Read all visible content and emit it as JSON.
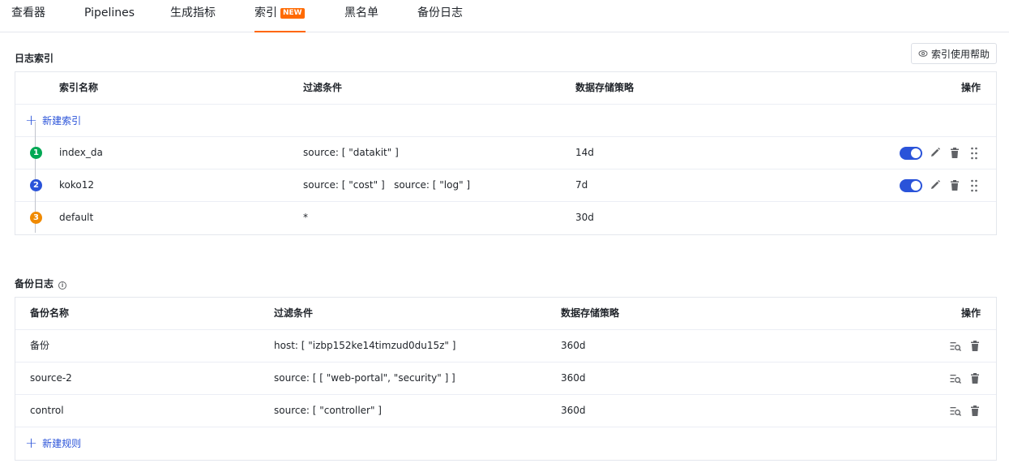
{
  "tabs": [
    {
      "label": "查看器"
    },
    {
      "label": "Pipelines"
    },
    {
      "label": "生成指标"
    },
    {
      "label": "索引",
      "badge": "NEW"
    },
    {
      "label": "黑名单"
    },
    {
      "label": "备份日志"
    }
  ],
  "active_tab": "索引",
  "accent_color": "#ff6600",
  "link_color": "#2a53d9",
  "log_index": {
    "title": "日志索引",
    "help_button": "索引使用帮助",
    "help_icon": "eye-icon",
    "columns": [
      "索引名称",
      "过滤条件",
      "数据存储策略",
      "操作"
    ],
    "add_label": "新建索引",
    "rows": [
      {
        "no": "1",
        "name": "index_da",
        "filter": "source: [ \"datakit\" ]",
        "retention": "14d",
        "enabled": true,
        "color": "#00a854"
      },
      {
        "no": "2",
        "name": "koko12",
        "filter": "source: [ \"cost\" ]   source: [ \"log\" ]",
        "retention": "7d",
        "enabled": true,
        "color": "#2a53d9"
      },
      {
        "no": "3",
        "name": "default",
        "filter": "*",
        "retention": "30d",
        "color": "#f08a00"
      }
    ]
  },
  "backup_log": {
    "title": "备份日志",
    "info_icon": "info-icon",
    "columns": [
      "备份名称",
      "过滤条件",
      "数据存储策略",
      "操作"
    ],
    "add_label": "新建规则",
    "rows": [
      {
        "name": "备份",
        "filter": "host: [ \"izbp152ke14timzud0du15z\" ]",
        "retention": "360d"
      },
      {
        "name": "source-2",
        "filter": "source: [ [ \"web-portal\", \"security\" ] ]",
        "retention": "360d"
      },
      {
        "name": "control",
        "filter": "source: [ \"controller\" ]",
        "retention": "360d"
      }
    ]
  }
}
